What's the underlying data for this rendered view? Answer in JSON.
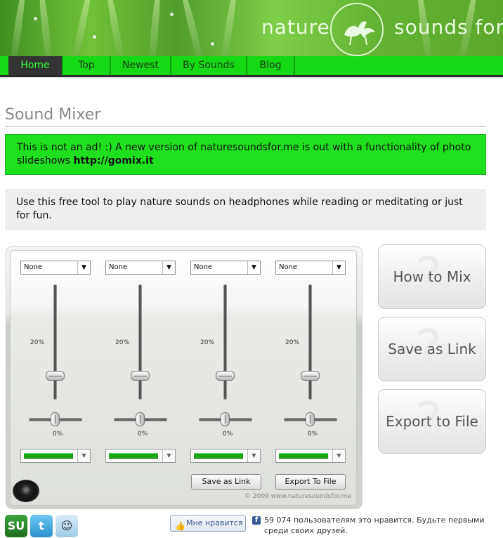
{
  "header": {
    "logo_left": "nature",
    "logo_right": "sounds for ."
  },
  "nav": {
    "items": [
      {
        "label": "Home",
        "active": true
      },
      {
        "label": "Top",
        "active": false
      },
      {
        "label": "Newest",
        "active": false
      },
      {
        "label": "By Sounds",
        "active": false
      },
      {
        "label": "Blog",
        "active": false
      }
    ]
  },
  "page": {
    "title": "Sound Mixer",
    "notice_text": "This is not an ad! :) A new version of naturesoundsfor.me is out with a functionality of photo slideshows ",
    "notice_link": "http://gomix.it",
    "intro": "Use this free tool to play nature sounds on headphones while reading or meditating or just for fun."
  },
  "mixer": {
    "channels": [
      {
        "sound": "None",
        "volume_label": "20",
        "volume_unit": "%",
        "pan_label": "0",
        "pan_unit": "%",
        "volume": 0.2,
        "pan": 0.0
      },
      {
        "sound": "None",
        "volume_label": "20",
        "volume_unit": "%",
        "pan_label": "0",
        "pan_unit": "%",
        "volume": 0.2,
        "pan": 0.0
      },
      {
        "sound": "None",
        "volume_label": "20",
        "volume_unit": "%",
        "pan_label": "0",
        "pan_unit": "%",
        "volume": 0.2,
        "pan": 0.0
      },
      {
        "sound": "None",
        "volume_label": "20",
        "volume_unit": "%",
        "pan_label": "0",
        "pan_unit": "%",
        "volume": 0.2,
        "pan": 0.0
      }
    ],
    "save_link_label": "Save as Link",
    "export_file_label": "Export To File",
    "copyright": "© 2009 www.naturesoundsfor.me"
  },
  "side_buttons": {
    "how_to_mix": "How to Mix",
    "save_as_link": "Save as Link",
    "export_to_file": "Export to File"
  },
  "footer": {
    "share_icons": [
      "stumbleupon-icon",
      "twitter-icon",
      "reddit-icon"
    ],
    "like_button": "Мне нравится",
    "like_text": "59 074 пользователям это нравится. Будьте первыми среди своих друзей."
  },
  "colors": {
    "nav_green": "#15d915",
    "notice_green": "#1fe01f",
    "active_tab_text": "#39ff39"
  }
}
